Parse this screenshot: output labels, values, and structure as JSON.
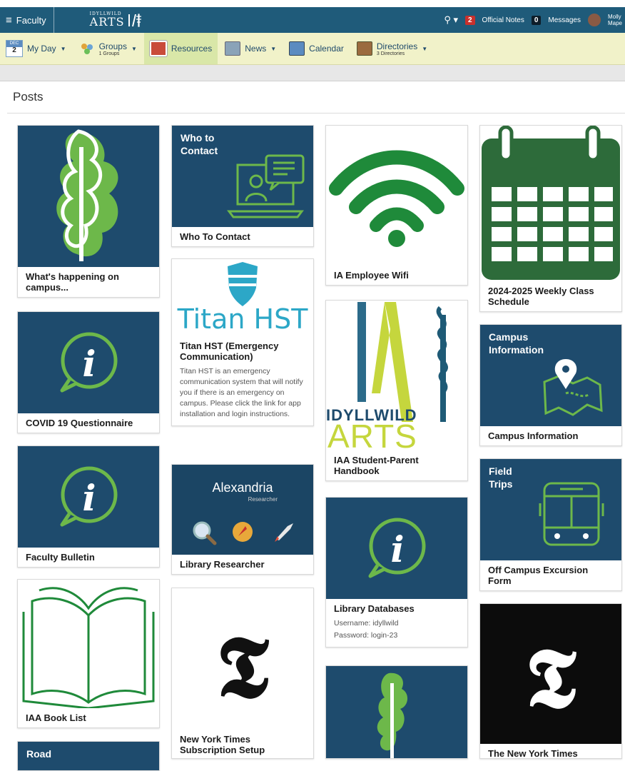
{
  "topbar": {
    "menu_label": "Faculty",
    "brand_small": "IDYLLWILD",
    "brand_big": "ARTS",
    "official_notes_count": "2",
    "official_notes_label": "Official Notes",
    "messages_count": "0",
    "messages_label": "Messages",
    "user_first": "Molly",
    "user_last": "Mape"
  },
  "nav": {
    "day_month": "DEC",
    "day_num": "2",
    "my_day": "My Day",
    "groups": "Groups",
    "groups_sub": "1 Groups",
    "resources": "Resources",
    "news": "News",
    "calendar": "Calendar",
    "directories": "Directories",
    "directories_sub": "3 Directories"
  },
  "page": {
    "title": "Posts"
  },
  "cards": {
    "happening": {
      "title": "What's happening on campus..."
    },
    "who_contact": {
      "thumb": "Who to Contact",
      "title": "Who To Contact"
    },
    "wifi": {
      "title": "IA Employee Wifi"
    },
    "schedule": {
      "title": "2024-2025 Weekly Class Schedule"
    },
    "titan": {
      "thumb": "Titan HST",
      "title": "Titan HST (Emergency Communication)",
      "desc": "Titan HST is an emergency communication system that will notify you if there is an emergency on campus. Please click the link for app installation and login instructions."
    },
    "covid": {
      "title": "COVID 19 Questionnaire"
    },
    "handbook": {
      "thumb_top": "IDYLLWILD",
      "thumb_bottom": "ARTS",
      "title": "IAA Student-Parent Handbook"
    },
    "campus": {
      "thumb": "Campus Information",
      "title": "Campus Information"
    },
    "bulletin": {
      "title": "Faculty Bulletin"
    },
    "library_res": {
      "thumb": "Alexandria",
      "thumb_sub": "Researcher",
      "title": "Library Researcher"
    },
    "field": {
      "thumb": "Field Trips",
      "title": "Off Campus Excursion Form"
    },
    "library_db": {
      "title": "Library Databases",
      "desc_user": "Username: idyllwild",
      "desc_pass": "Password: login-23"
    },
    "book": {
      "title": "IAA Book List"
    },
    "nyt": {
      "title": "New York Times Subscription Setup"
    },
    "nyt2": {
      "title": "The New York Times"
    },
    "road": {
      "thumb": "Road"
    }
  },
  "colors": {
    "navy": "#1e4b6d",
    "green": "#1f8a3a",
    "topbar": "#1f5b7a",
    "nav_bg": "#f1f2c9"
  }
}
